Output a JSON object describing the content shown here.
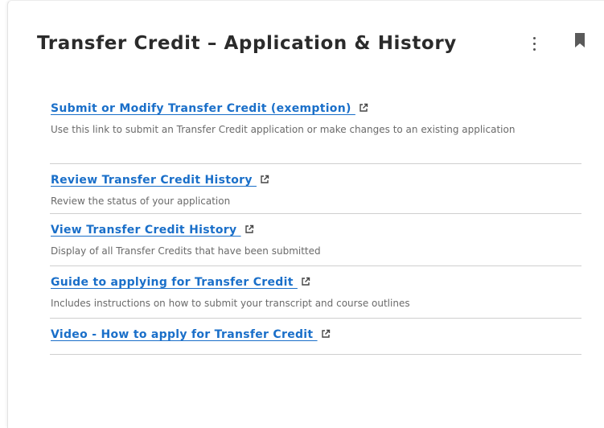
{
  "card": {
    "title": "Transfer Credit – Application & History",
    "menu_icon": "kebab-menu-icon",
    "bookmark_icon": "bookmark-icon"
  },
  "links": [
    {
      "label": "Submit or Modify Transfer Credit (exemption) ",
      "description": "Use this link to submit an Transfer Credit application or make changes to an existing application",
      "icon": "external-link-icon"
    },
    {
      "label": "Review Transfer Credit History ",
      "description": "Review the status of your application",
      "icon": "external-link-icon"
    },
    {
      "label": "View Transfer Credit History ",
      "description": "Display of all Transfer Credits that have been submitted",
      "icon": "external-link-icon"
    },
    {
      "label": "Guide to applying for Transfer Credit ",
      "description": "Includes instructions on how to submit your transcript and course outlines",
      "icon": "external-link-icon"
    },
    {
      "label": "Video - How to apply for Transfer Credit ",
      "icon": "external-link-icon"
    }
  ],
  "colors": {
    "link": "#1a6fc9",
    "title": "#2b2b2b",
    "description": "#6a6a6a",
    "divider": "#cfcfcf"
  }
}
